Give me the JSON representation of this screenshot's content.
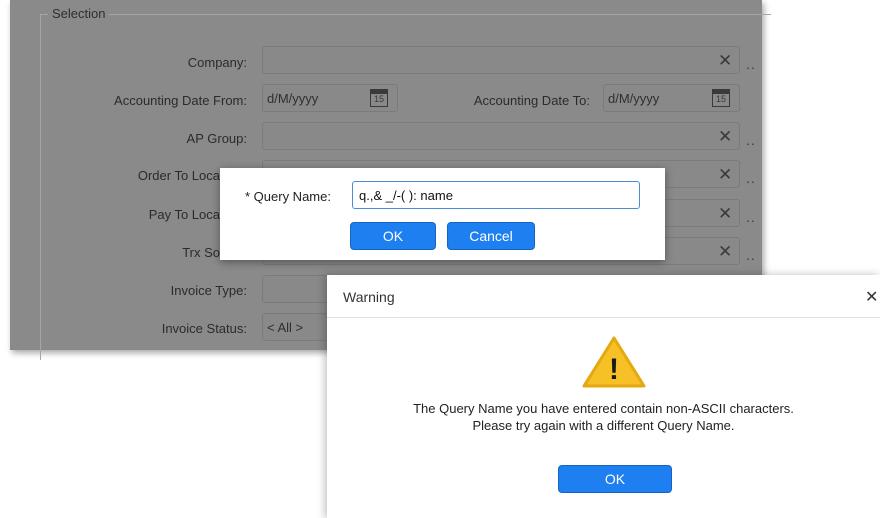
{
  "selection": {
    "legend": "Selection",
    "labels": {
      "company": "Company:",
      "acc_from": "Accounting Date From:",
      "acc_to": "Accounting Date To:",
      "ap_group": "AP Group:",
      "order_to": "Order To Loca",
      "pay_to": "Pay To Loca",
      "trx_source": "Trx So",
      "invoice_type": "Invoice Type:",
      "invoice_status": "Invoice Status:"
    },
    "date_placeholder": "d/M/yyyy",
    "calendar_day": "15",
    "invoice_status_value": "< All >",
    "clear_glyph": "✕",
    "more_glyph": ".."
  },
  "query_dialog": {
    "label": "* Query Name:",
    "value": "q.,& _/-( ): name",
    "ok": "OK",
    "cancel": "Cancel"
  },
  "warning_dialog": {
    "title": "Warning",
    "close_glyph": "✕",
    "message_line1": "The Query Name you have entered contain non-ASCII characters.",
    "message_line2": "Please try again with a different Query Name.",
    "ok": "OK",
    "icon_glyph": "!"
  },
  "colors": {
    "accent": "#1e7ff0",
    "warning_icon": "#f6c026",
    "dim_panel": "#8a8a8a"
  }
}
